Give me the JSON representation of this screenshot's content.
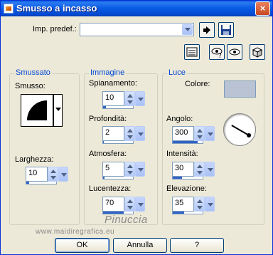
{
  "window": {
    "title": "Smusso a incasso",
    "close_label": "×"
  },
  "preset": {
    "label": "Imp. predef.:",
    "value": ""
  },
  "groups": {
    "smussato": {
      "title": "Smussato",
      "bevel_label": "Smusso:",
      "width_label": "Larghezza:",
      "width_value": "10",
      "width_fraction": 0.1
    },
    "immagine": {
      "title": "Immagine",
      "fields": [
        {
          "label": "Spianamento:",
          "value": "10",
          "fraction": 0.1
        },
        {
          "label": "Profondità:",
          "value": "2",
          "fraction": 0.02
        },
        {
          "label": "Atmosfera:",
          "value": "5",
          "fraction": 0.05
        },
        {
          "label": "Lucentezza:",
          "value": "70",
          "fraction": 0.7
        }
      ]
    },
    "luce": {
      "title": "Luce",
      "color_label": "Colore:",
      "color_value": "#b9c3d3",
      "fields": [
        {
          "label": "Angolo:",
          "value": "300",
          "fraction": 0.83
        },
        {
          "label": "Intensità:",
          "value": "30",
          "fraction": 0.3
        },
        {
          "label": "Elevazione:",
          "value": "35",
          "fraction": 0.39
        }
      ],
      "dial_angle_deg": 300
    }
  },
  "watermark": {
    "name": "Pinuccia",
    "url": "www.maidiregrafica.eu"
  },
  "buttons": {
    "ok": "OK",
    "cancel": "Annulla",
    "help": "?"
  },
  "icons": [
    "load-preset-icon",
    "save-preset-icon",
    "show-settings-icon",
    "randomize-icon",
    "preview-on-icon",
    "random-dice-icon"
  ]
}
